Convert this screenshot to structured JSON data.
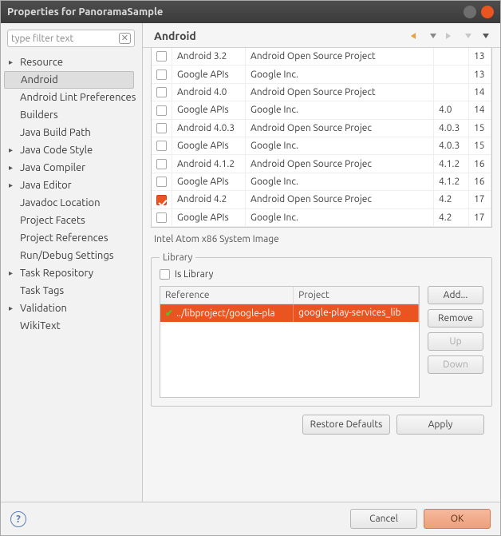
{
  "window": {
    "title": "Properties for PanoramaSample"
  },
  "filter": {
    "placeholder": "type filter text"
  },
  "tree": [
    {
      "label": "Resource",
      "expandable": true
    },
    {
      "label": "Android",
      "expandable": false,
      "selected": true
    },
    {
      "label": "Android Lint Preferences",
      "expandable": false
    },
    {
      "label": "Builders",
      "expandable": false
    },
    {
      "label": "Java Build Path",
      "expandable": false
    },
    {
      "label": "Java Code Style",
      "expandable": true
    },
    {
      "label": "Java Compiler",
      "expandable": true
    },
    {
      "label": "Java Editor",
      "expandable": true
    },
    {
      "label": "Javadoc Location",
      "expandable": false
    },
    {
      "label": "Project Facets",
      "expandable": false
    },
    {
      "label": "Project References",
      "expandable": false
    },
    {
      "label": "Run/Debug Settings",
      "expandable": false
    },
    {
      "label": "Task Repository",
      "expandable": true
    },
    {
      "label": "Task Tags",
      "expandable": false
    },
    {
      "label": "Validation",
      "expandable": true
    },
    {
      "label": "WikiText",
      "expandable": false
    }
  ],
  "page": {
    "title": "Android",
    "subcaption": "Intel Atom x86 System Image"
  },
  "targets": [
    {
      "checked": false,
      "name": "Android 3.2",
      "vendor": "Android Open Source Project",
      "ver": "",
      "api": "13"
    },
    {
      "checked": false,
      "name": "Google APIs",
      "vendor": "Google Inc.",
      "ver": "",
      "api": "13"
    },
    {
      "checked": false,
      "name": "Android 4.0",
      "vendor": "Android Open Source Project",
      "ver": "",
      "api": "14"
    },
    {
      "checked": false,
      "name": "Google APIs",
      "vendor": "Google Inc.",
      "ver": "4.0",
      "api": "14"
    },
    {
      "checked": false,
      "name": "Android 4.0.3",
      "vendor": "Android Open Source Projec",
      "ver": "4.0.3",
      "api": "15"
    },
    {
      "checked": false,
      "name": "Google APIs",
      "vendor": "Google Inc.",
      "ver": "4.0.3",
      "api": "15"
    },
    {
      "checked": false,
      "name": "Android 4.1.2",
      "vendor": "Android Open Source Projec",
      "ver": "4.1.2",
      "api": "16"
    },
    {
      "checked": false,
      "name": "Google APIs",
      "vendor": "Google Inc.",
      "ver": "4.1.2",
      "api": "16"
    },
    {
      "checked": true,
      "name": "Android 4.2",
      "vendor": "Android Open Source Projec",
      "ver": "4.2",
      "api": "17"
    },
    {
      "checked": false,
      "name": "Google APIs",
      "vendor": "Google Inc.",
      "ver": "4.2",
      "api": "17"
    }
  ],
  "library": {
    "legend": "Library",
    "is_library_label": "Is Library",
    "is_library_checked": false,
    "headers": {
      "reference": "Reference",
      "project": "Project"
    },
    "rows": [
      {
        "reference": "../libproject/google-pla",
        "project": "google-play-services_lib",
        "ok": true,
        "selected": true
      }
    ],
    "buttons": {
      "add": "Add...",
      "remove": "Remove",
      "up": "Up",
      "down": "Down"
    }
  },
  "actions": {
    "restore": "Restore Defaults",
    "apply": "Apply",
    "cancel": "Cancel",
    "ok": "OK"
  }
}
